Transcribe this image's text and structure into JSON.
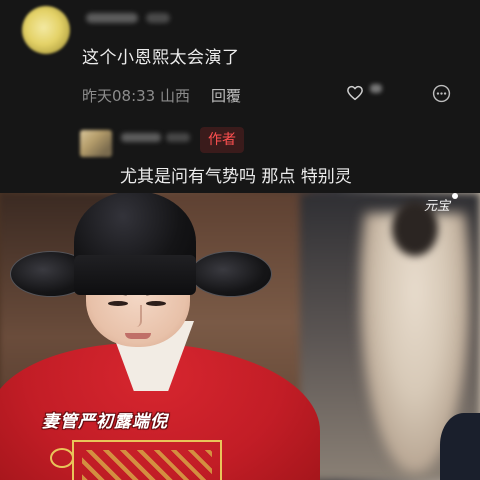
{
  "comment": {
    "text": "这个小恩熙太会演了",
    "meta": "昨天08:33 山西",
    "reply_label": "回覆"
  },
  "reply": {
    "author_badge": "作者",
    "text": "尤其是问有气势吗 那点 特别灵"
  },
  "video": {
    "subtitle": "妻管严初露端倪",
    "watermark": "元宝"
  },
  "icons": {
    "like": "heart-outline-icon",
    "more": "more-options-icon"
  },
  "colors": {
    "background": "#161616",
    "badge_text": "#ff5050",
    "robe_red": "#c21d26"
  }
}
